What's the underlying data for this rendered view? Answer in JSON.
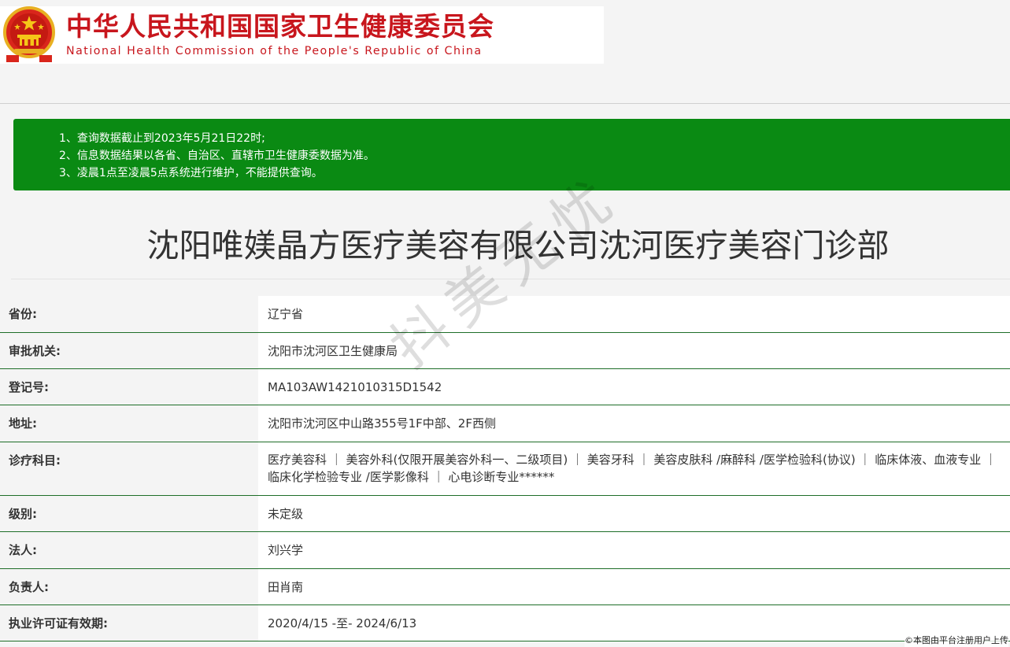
{
  "header": {
    "title_cn": "中华人民共和国国家卫生健康委员会",
    "title_en": "National Health Commission of the People's Republic of China",
    "emblem_icon": "national-emblem-icon"
  },
  "notice": {
    "lines": [
      "1、查询数据截止到2023年5月21日22时;",
      "2、信息数据结果以各省、自治区、直辖市卫生健康委数据为准。",
      "3、凌晨1点至凌晨5点系统进行维护，不能提供查询。"
    ]
  },
  "organization": {
    "name": "沈阳唯媄晶方医疗美容有限公司沈河医疗美容门诊部"
  },
  "details": [
    {
      "label": "省份:",
      "value": "辽宁省"
    },
    {
      "label": "审批机关:",
      "value": "沈阳市沈河区卫生健康局"
    },
    {
      "label": "登记号:",
      "value": "MA103AW1421010315D1542"
    },
    {
      "label": "地址:",
      "value": "沈阳市沈河区中山路355号1F中部、2F西侧"
    },
    {
      "label": "诊疗科目:",
      "value": "医疗美容科 ｜ 美容外科(仅限开展美容外科一、二级项目) ｜ 美容牙科 ｜ 美容皮肤科 /麻醉科 /医学检验科(协议) ｜ 临床体液、血液专业 ｜ 临床化学检验专业 /医学影像科 ｜ 心电诊断专业******"
    },
    {
      "label": "级别:",
      "value": "未定级"
    },
    {
      "label": "法人:",
      "value": "刘兴学"
    },
    {
      "label": "负责人:",
      "value": "田肖南"
    },
    {
      "label": "执业许可证有效期:",
      "value": "2020/4/15 -至- 2024/6/13"
    }
  ],
  "watermark": "抖美无忧",
  "credit": "©本图由平台注册用户上传",
  "colors": {
    "brand_red": "#c8161d",
    "notice_green": "#0a8a13",
    "row_border": "#1e6e28"
  }
}
